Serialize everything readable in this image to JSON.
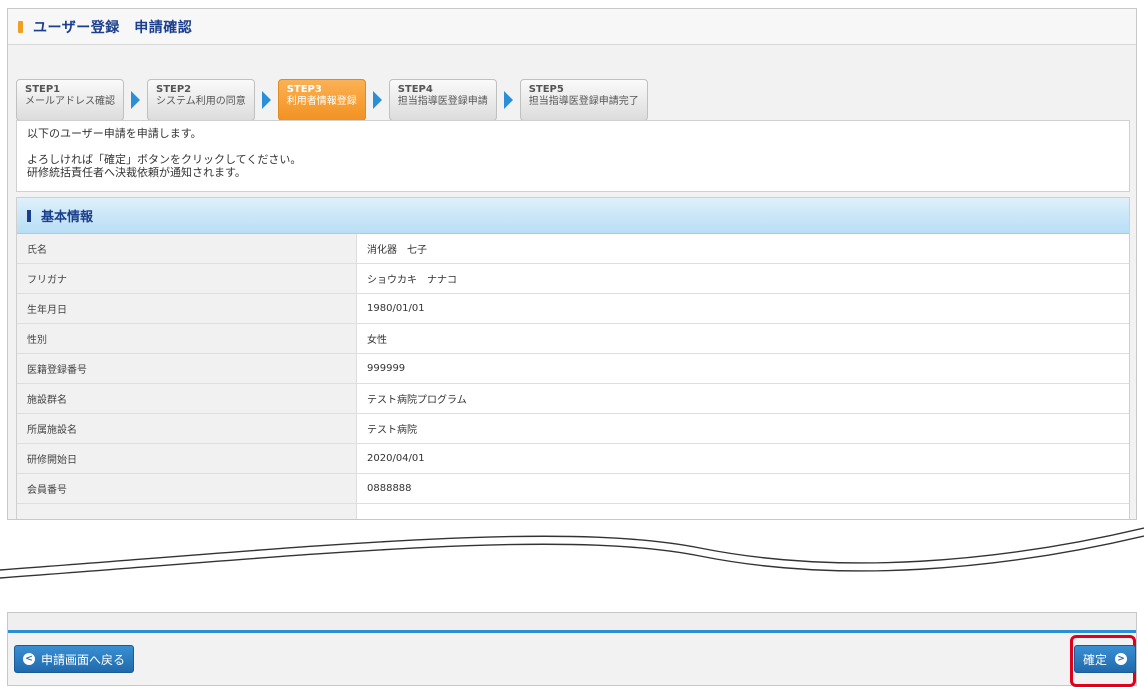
{
  "header": {
    "title": "ユーザー登録　申請確認"
  },
  "steps": [
    {
      "num": "STEP1",
      "label": "メールアドレス確認"
    },
    {
      "num": "STEP2",
      "label": "システム利用の同意"
    },
    {
      "num": "STEP3",
      "label": "利用者情報登録"
    },
    {
      "num": "STEP4",
      "label": "担当指導医登録申請"
    },
    {
      "num": "STEP5",
      "label": "担当指導医登録申請完了"
    }
  ],
  "message": {
    "line1": "以下のユーザー申請を申請します。",
    "line2": "よろしければ「確定」ボタンをクリックしてください。",
    "line3": "研修統括責任者へ決裁依頼が通知されます。"
  },
  "info": {
    "title": "基本情報",
    "rows": [
      {
        "label": "氏名",
        "value": "消化器　七子"
      },
      {
        "label": "フリガナ",
        "value": "ショウカキ　ナナコ"
      },
      {
        "label": "生年月日",
        "value": "1980/01/01"
      },
      {
        "label": "性別",
        "value": "女性"
      },
      {
        "label": "医籍登録番号",
        "value": "999999"
      },
      {
        "label": "施設群名",
        "value": "テスト病院プログラム"
      },
      {
        "label": "所属施設名",
        "value": "テスト病院"
      },
      {
        "label": "研修開始日",
        "value": "2020/04/01"
      },
      {
        "label": "会員番号",
        "value": "0888888"
      }
    ]
  },
  "footer": {
    "back_label": "申請画面へ戻る",
    "confirm_label": "確定"
  },
  "colors": {
    "accent": "#2a8fd6",
    "active_step": "#f29222",
    "highlight": "#e0001b"
  }
}
